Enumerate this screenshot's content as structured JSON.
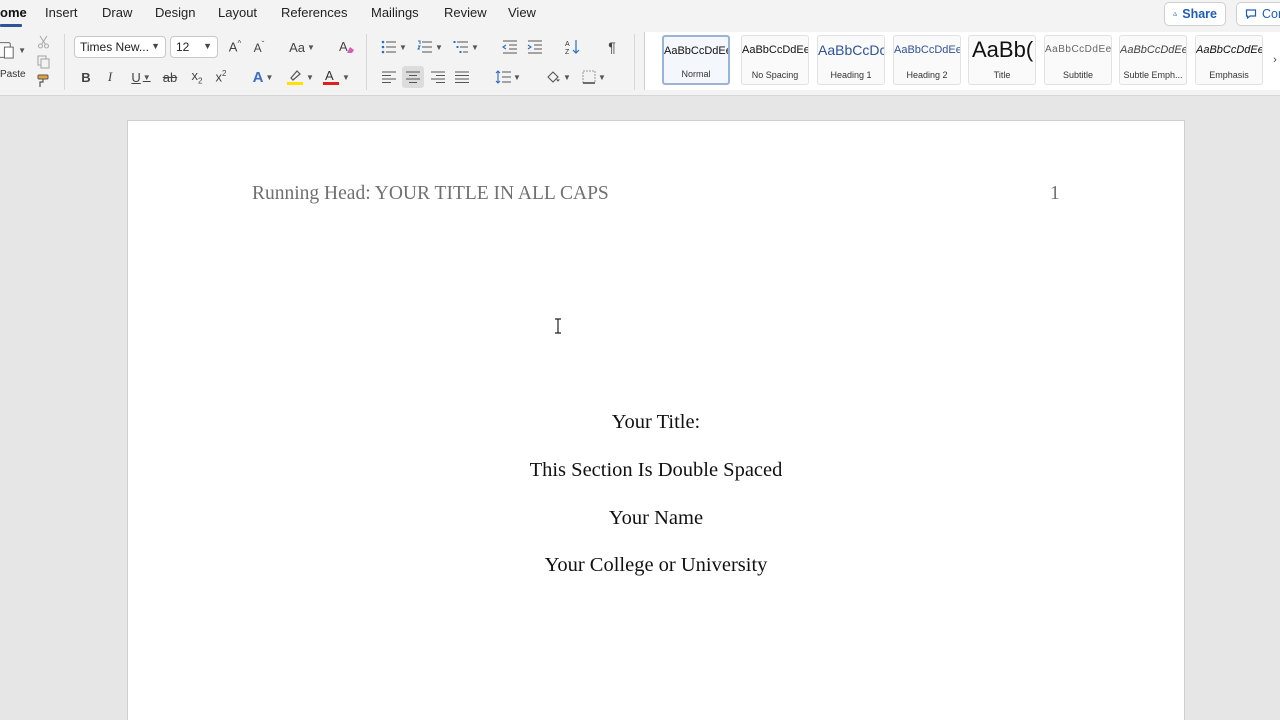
{
  "tabs": [
    "ome",
    "Insert",
    "Draw",
    "Design",
    "Layout",
    "References",
    "Mailings",
    "Review",
    "View"
  ],
  "active_tab": "ome",
  "share_label": "Share",
  "comments_label": "Con",
  "clipboard": {
    "paste_label": "Paste"
  },
  "font": {
    "family": "Times New...",
    "size": "12"
  },
  "styles": [
    {
      "sample": "AaBbCcDdEe",
      "name": "Normal"
    },
    {
      "sample": "AaBbCcDdEe",
      "name": "No Spacing"
    },
    {
      "sample": "AaBbCcDc",
      "name": "Heading 1"
    },
    {
      "sample": "AaBbCcDdEe",
      "name": "Heading 2"
    },
    {
      "sample": "AaBb(",
      "name": "Title"
    },
    {
      "sample": "AaBbCcDdEe",
      "name": "Subtitle"
    },
    {
      "sample": "AaBbCcDdEe",
      "name": "Subtle Emph..."
    },
    {
      "sample": "AaBbCcDdEe",
      "name": "Emphasis"
    }
  ],
  "document": {
    "header_left": "Running Head: YOUR TITLE IN ALL CAPS",
    "page_number": "1",
    "title_lines": [
      "Your Title:",
      "This Section Is Double Spaced",
      "Your Name",
      "Your College or University"
    ]
  },
  "colors": {
    "accent": "#2b579a",
    "highlight": "#ffe100",
    "font_color": "#e0201b",
    "share_text": "#1e5fb4"
  }
}
